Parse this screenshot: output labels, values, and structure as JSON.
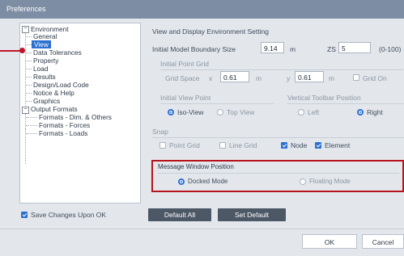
{
  "window": {
    "title": "Preferences"
  },
  "tree": {
    "items": [
      {
        "label": "Environment",
        "level": 0,
        "expanded": true
      },
      {
        "label": "General",
        "level": 1
      },
      {
        "label": "View",
        "level": 1,
        "selected": true
      },
      {
        "label": "Data Tolerances",
        "level": 1
      },
      {
        "label": "Property",
        "level": 1
      },
      {
        "label": "Load",
        "level": 1
      },
      {
        "label": "Results",
        "level": 1
      },
      {
        "label": "Design/Load Code",
        "level": 1
      },
      {
        "label": "Notice & Help",
        "level": 1
      },
      {
        "label": "Graphics",
        "level": 1
      },
      {
        "label": "Output Formats",
        "level": 0,
        "expanded": true
      },
      {
        "label": "Formats - Dim. & Others",
        "level": 1
      },
      {
        "label": "Formats - Forces",
        "level": 1
      },
      {
        "label": "Formats - Loads",
        "level": 1
      }
    ]
  },
  "panel": {
    "heading": "View and Display Environment Setting",
    "boundary": {
      "label": "Initial Model Boundary Size",
      "value": "9.14",
      "unit": "m",
      "zs_label": "ZS",
      "zs_value": "5",
      "zs_range": "(0-100)"
    },
    "grid": {
      "group": "Initial Point Grid",
      "label": "Grid Space",
      "x_label": "x",
      "x_value": "0.61",
      "x_unit": "m",
      "y_label": "y",
      "y_value": "0.61",
      "y_unit": "m",
      "grid_on_label": "Grid On",
      "grid_on": false
    },
    "viewpoint": {
      "group": "Initial View Point",
      "options": [
        "Iso-View",
        "Top View"
      ],
      "selected": "Iso-View"
    },
    "toolbar_pos": {
      "group": "Vertical Toolbar Position",
      "options": [
        "Left",
        "Right"
      ],
      "selected": "Right"
    },
    "snap": {
      "group": "Snap",
      "items": [
        {
          "label": "Point Grid",
          "checked": false
        },
        {
          "label": "Line Grid",
          "checked": false
        },
        {
          "label": "Node",
          "checked": true
        },
        {
          "label": "Element",
          "checked": true
        }
      ]
    },
    "message_window": {
      "group": "Message Window Position",
      "options": [
        "Docked Mode",
        "Floating Mode"
      ],
      "selected": "Docked Mode"
    }
  },
  "footer": {
    "save_label": "Save Changes Upon OK",
    "save_checked": true,
    "default_all": "Default All",
    "set_default": "Set Default",
    "ok": "OK",
    "cancel": "Cancel"
  },
  "colors": {
    "accent": "#2c6fd1",
    "highlight": "#b6131b",
    "titlebar": "#7d8da3"
  }
}
